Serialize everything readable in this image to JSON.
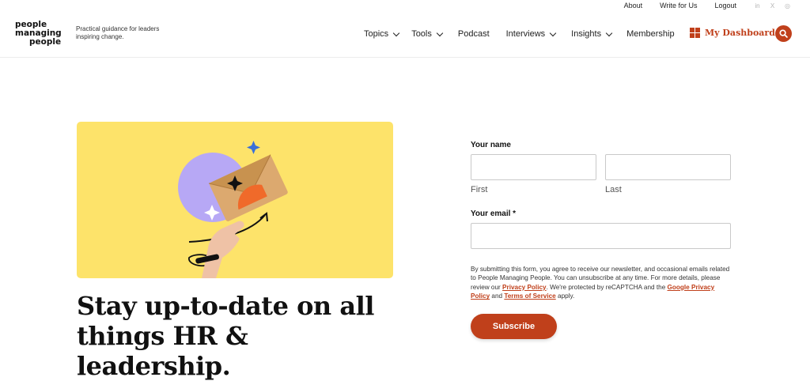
{
  "utility": {
    "about": "About",
    "write_for_us": "Write for Us",
    "logout": "Logout",
    "social_icons": [
      "linkedin-icon",
      "x-icon",
      "instagram-icon"
    ],
    "social_glyphs": [
      "in",
      "X",
      "◎"
    ]
  },
  "brand": {
    "line1": "people",
    "line2": "managing",
    "line3": "people",
    "tagline": "Practical guidance for leaders inspiring change."
  },
  "nav": {
    "items": [
      {
        "label": "Topics",
        "dropdown": true
      },
      {
        "label": "Tools",
        "dropdown": true
      },
      {
        "label": "Podcast",
        "dropdown": false
      },
      {
        "label": "Interviews",
        "dropdown": true
      },
      {
        "label": "Insights",
        "dropdown": true
      },
      {
        "label": "Membership",
        "dropdown": false
      }
    ],
    "dashboard": "My Dashboard"
  },
  "hero": {
    "headline": "Stay up-to-date on all things HR & leadership."
  },
  "form": {
    "name_label": "Your name",
    "first_value": "",
    "last_value": "",
    "first_sub": "First",
    "last_sub": "Last",
    "email_label": "Your email *",
    "email_value": "",
    "legal_text": "By submitting this form, you agree to receive our newsletter, and occasional emails related to People Managing People. You can unsubscribe at any time. For more details, please review our ",
    "privacy_link": "Privacy Policy",
    "legal_mid": ". We're protected by reCAPTCHA and the ",
    "google_link": "Google Privacy Policy",
    "legal_and": " and ",
    "terms_link": "Terms of Service",
    "legal_end": " apply.",
    "submit": "Subscribe"
  },
  "colors": {
    "accent": "#c0401b",
    "hero_bg": "#fde36a",
    "blob": "#b7a8f5",
    "envelope": "#dca96f"
  }
}
